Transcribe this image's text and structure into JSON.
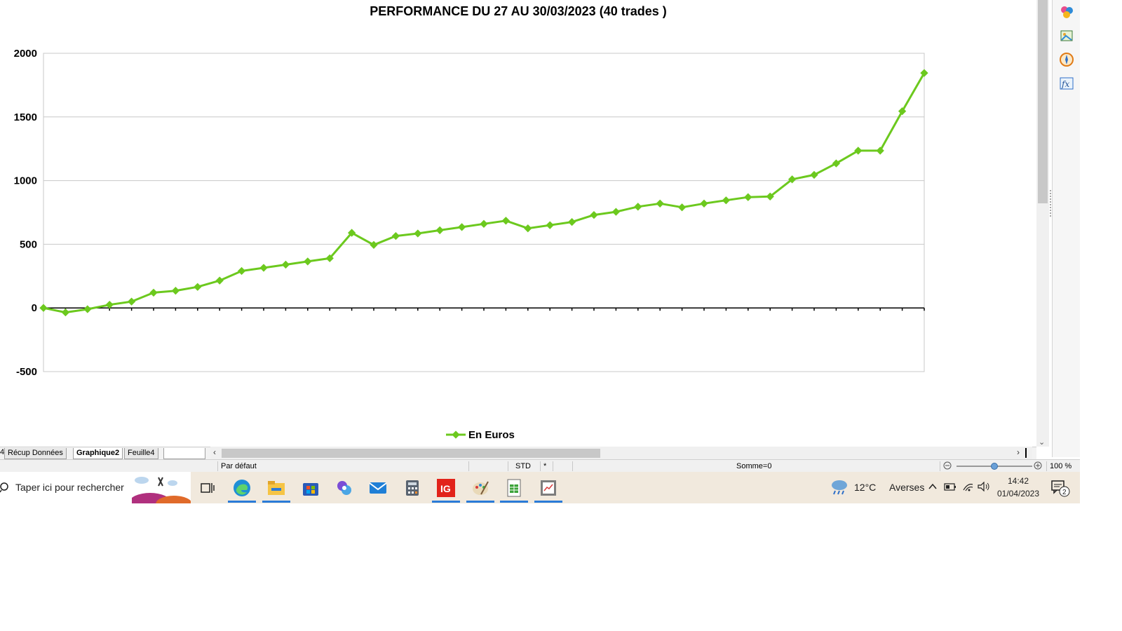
{
  "chart_data": {
    "type": "line",
    "title": "PERFORMANCE DU 27 AU 30/03/2023 (40 trades )",
    "ylim": [
      -500,
      2000
    ],
    "yticks": [
      2000,
      1500,
      1000,
      500,
      0,
      -500
    ],
    "grid": true,
    "legend_position": "bottom",
    "colors": {
      "series": "#6cc91e",
      "grid": "#c8c8c8",
      "axis": "#000000"
    },
    "series": [
      {
        "name": "En Euros",
        "values": [
          0,
          -35,
          -10,
          25,
          50,
          120,
          135,
          165,
          215,
          290,
          315,
          340,
          365,
          390,
          590,
          495,
          565,
          585,
          610,
          635,
          660,
          685,
          625,
          650,
          675,
          730,
          755,
          795,
          820,
          790,
          820,
          845,
          870,
          875,
          1010,
          1045,
          1135,
          1235,
          1235,
          1545,
          1845
        ]
      }
    ]
  },
  "sheet_tabs": {
    "left_fragment": "4",
    "items": [
      {
        "label": "Récup Données",
        "active": false
      },
      {
        "label": "Graphique2",
        "active": true
      },
      {
        "label": "Feuille4",
        "active": false
      }
    ]
  },
  "status_bar": {
    "page_style": "Par défaut",
    "mode": "STD",
    "modified": "*",
    "sum": "Somme=0",
    "zoom": "100 %"
  },
  "taskbar": {
    "search_placeholder": "Taper ici pour rechercher",
    "weather_temp": "12°C",
    "weather_desc": "Averses",
    "time": "14:42",
    "date": "01/04/2023",
    "notification_count": "2",
    "ig_label": "IG",
    "apps": [
      "task-view",
      "edge",
      "file-explorer",
      "microsoft-store",
      "copilot",
      "mail",
      "calculator",
      "ig",
      "paint",
      "libreoffice-calc",
      "chart-viewer"
    ]
  },
  "side_panel": {
    "icons": [
      "styles-icon",
      "gallery-icon",
      "navigator-icon",
      "functions-icon"
    ]
  }
}
